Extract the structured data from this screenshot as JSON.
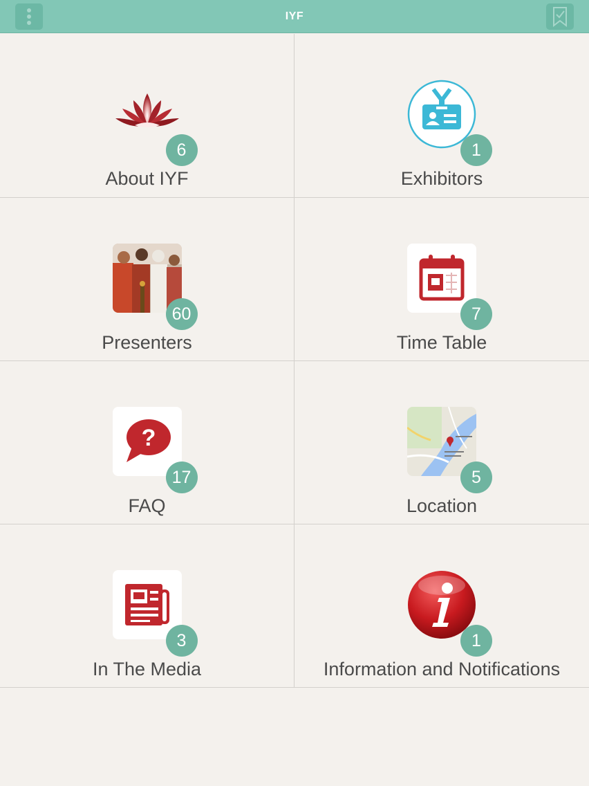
{
  "header": {
    "title": "IYF",
    "menu_icon": "vertical-dots-icon",
    "bookmark_icon": "bookmark-check-icon"
  },
  "tiles": [
    {
      "label": "About IYF",
      "badge": "6",
      "icon": "lotus-icon"
    },
    {
      "label": "Exhibitors",
      "badge": "1",
      "icon": "id-badge-icon"
    },
    {
      "label": "Presenters",
      "badge": "60",
      "icon": "presenters-photo"
    },
    {
      "label": "Time Table",
      "badge": "7",
      "icon": "calendar-icon"
    },
    {
      "label": "FAQ",
      "badge": "17",
      "icon": "question-bubble-icon"
    },
    {
      "label": "Location",
      "badge": "5",
      "icon": "map-thumbnail"
    },
    {
      "label": "In The Media",
      "badge": "3",
      "icon": "newspaper-icon"
    },
    {
      "label": "Information and Notifications",
      "badge": "1",
      "icon": "info-icon"
    }
  ],
  "colors": {
    "header": "#82c7b6",
    "badge": "#6fb4a0",
    "accent_red": "#c0272d",
    "background": "#f4f1ed"
  }
}
